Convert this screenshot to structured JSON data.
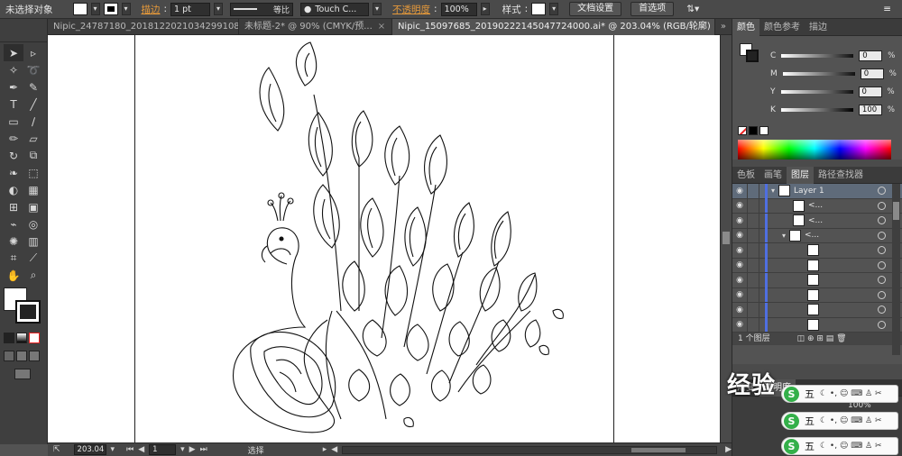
{
  "control_bar": {
    "selection_label": "未选择对象",
    "stroke_label": "描边",
    "stroke_weight": "1 pt",
    "stroke_profile": "等比",
    "brush_name": "Touch C...",
    "opacity_label": "不透明度",
    "opacity_value": "100%",
    "style_label": "样式",
    "doc_setup_button": "文档设置",
    "prefs_button": "首选项"
  },
  "tabs": [
    {
      "label": "Nipic_24787180_20181220210342991089.ai*",
      "active": false
    },
    {
      "label": "未标题-2* @ 90% (CMYK/预...",
      "active": false
    },
    {
      "label": "Nipic_15097685_20190222145047724000.ai* @ 203.04% (RGB/轮廓)",
      "active": true
    }
  ],
  "color_panel": {
    "tabs": [
      "颜色",
      "颜色参考",
      "描边"
    ],
    "channels": [
      {
        "name": "C",
        "value": "0"
      },
      {
        "name": "M",
        "value": "0"
      },
      {
        "name": "Y",
        "value": "0"
      },
      {
        "name": "K",
        "value": "100"
      }
    ],
    "percent": "%"
  },
  "layers_panel": {
    "tabs": [
      "色板",
      "画笔",
      "图层",
      "路径查找器"
    ],
    "layer_name": "Layer 1",
    "sub_item_label": "<...",
    "footer_count": "1 个图层"
  },
  "lower_panel": {
    "tabs": [
      "渐变",
      "透明度"
    ],
    "opacity": "100%"
  },
  "status_bar": {
    "zoom": "203.04",
    "page": "1",
    "mode": "选择"
  },
  "watermark": {
    "logo_text": "经验",
    "ime_text": "五"
  }
}
